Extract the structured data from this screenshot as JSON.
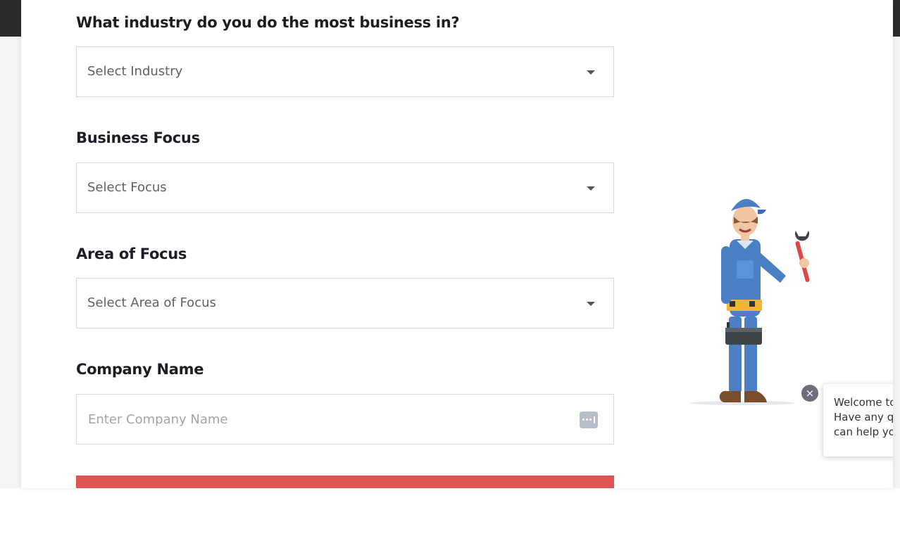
{
  "form": {
    "industry": {
      "label": "What industry do you do the most business in?",
      "placeholder": "Select Industry"
    },
    "business_focus": {
      "label": "Business Focus",
      "placeholder": "Select Focus"
    },
    "area_of_focus": {
      "label": "Area of Focus",
      "placeholder": "Select Area of Focus"
    },
    "company_name": {
      "label": "Company Name",
      "placeholder": "Enter Company Name",
      "value": ""
    }
  },
  "chat": {
    "lines": [
      "Welcome to",
      "Have any qu",
      "can help yo"
    ]
  },
  "colors": {
    "accent": "#e05353",
    "label_text": "#1d1d27",
    "dark_header": "#2b2b2b"
  },
  "icons": {
    "select_caret": "chevron-down-icon",
    "password_manager": "password-manager-icon",
    "close": "close-icon",
    "illustration": "mechanic-illustration"
  }
}
